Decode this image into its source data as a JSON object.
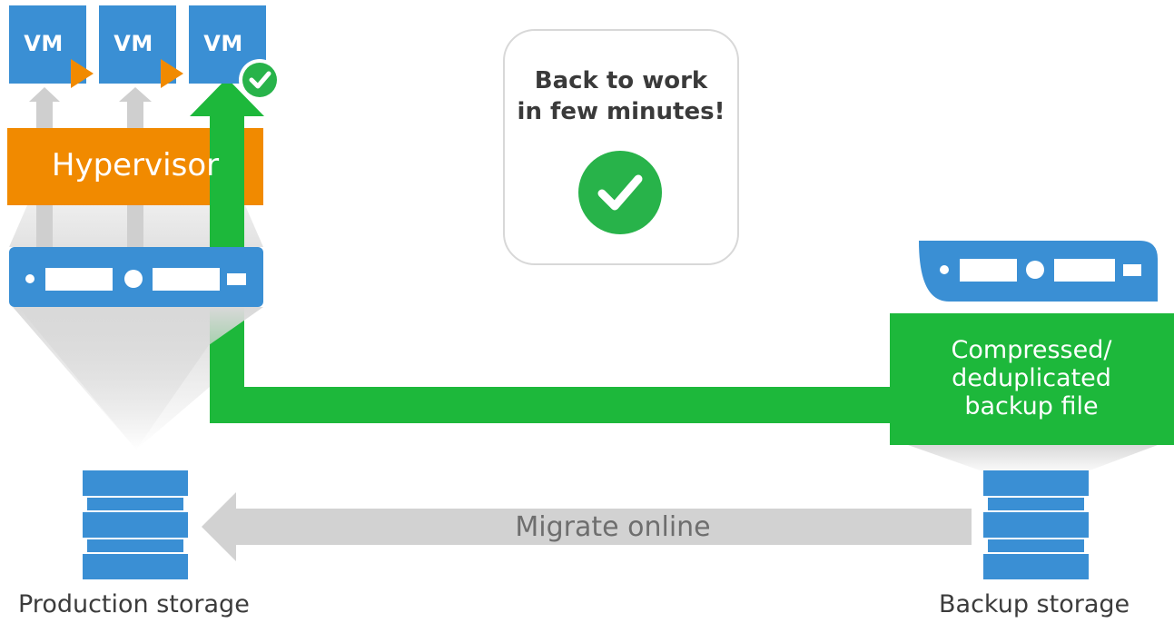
{
  "vms": [
    {
      "label": "VM"
    },
    {
      "label": "VM"
    },
    {
      "label": "VM"
    }
  ],
  "hypervisor": {
    "label": "Hypervisor"
  },
  "callout": {
    "title": "Back to work\nin few minutes!"
  },
  "backup_file": {
    "label": "Compressed/\ndeduplicated\nbackup file"
  },
  "migrate": {
    "label": "Migrate online"
  },
  "production_storage": {
    "label": "Production storage"
  },
  "backup_storage": {
    "label": "Backup storage"
  },
  "colors": {
    "vm_blue": "#3a8fd4",
    "play_orange": "#f18a00",
    "hypervisor_orange": "#f18a00",
    "recovery_green": "#1db83b",
    "check_green": "#28b34a",
    "arrow_gray": "#d2d2d2",
    "server_blue": "#3a8fd4"
  },
  "icons": {
    "vm_play": "play-triangle-icon",
    "restored_check": "check-circle-icon",
    "callout_check": "check-circle-icon",
    "host_server": "server-icon",
    "backup_server": "server-icon",
    "production_db": "database-stack-icon",
    "backup_db": "database-stack-icon"
  }
}
